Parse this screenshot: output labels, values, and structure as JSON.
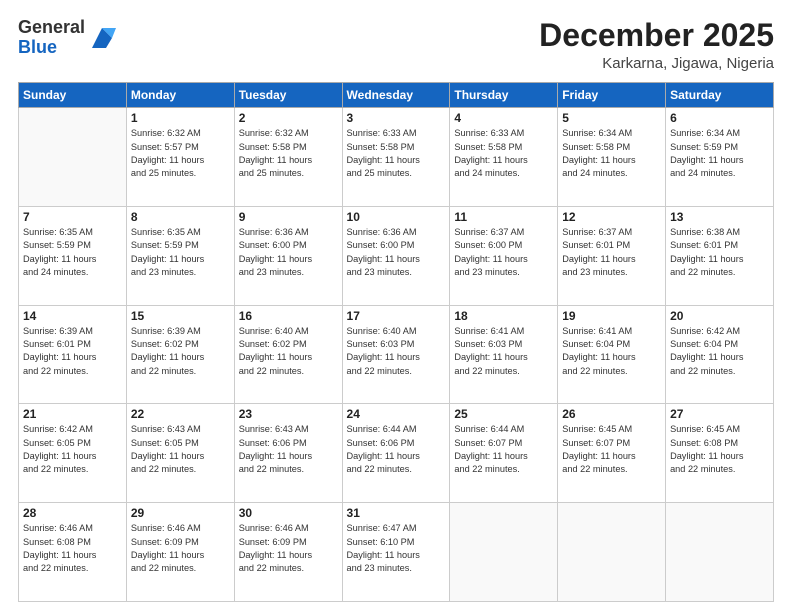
{
  "header": {
    "logo_general": "General",
    "logo_blue": "Blue",
    "month_title": "December 2025",
    "subtitle": "Karkarna, Jigawa, Nigeria"
  },
  "weekdays": [
    "Sunday",
    "Monday",
    "Tuesday",
    "Wednesday",
    "Thursday",
    "Friday",
    "Saturday"
  ],
  "weeks": [
    [
      {
        "day": "",
        "info": ""
      },
      {
        "day": "1",
        "info": "Sunrise: 6:32 AM\nSunset: 5:57 PM\nDaylight: 11 hours\nand 25 minutes."
      },
      {
        "day": "2",
        "info": "Sunrise: 6:32 AM\nSunset: 5:58 PM\nDaylight: 11 hours\nand 25 minutes."
      },
      {
        "day": "3",
        "info": "Sunrise: 6:33 AM\nSunset: 5:58 PM\nDaylight: 11 hours\nand 25 minutes."
      },
      {
        "day": "4",
        "info": "Sunrise: 6:33 AM\nSunset: 5:58 PM\nDaylight: 11 hours\nand 24 minutes."
      },
      {
        "day": "5",
        "info": "Sunrise: 6:34 AM\nSunset: 5:58 PM\nDaylight: 11 hours\nand 24 minutes."
      },
      {
        "day": "6",
        "info": "Sunrise: 6:34 AM\nSunset: 5:59 PM\nDaylight: 11 hours\nand 24 minutes."
      }
    ],
    [
      {
        "day": "7",
        "info": "Sunrise: 6:35 AM\nSunset: 5:59 PM\nDaylight: 11 hours\nand 24 minutes."
      },
      {
        "day": "8",
        "info": "Sunrise: 6:35 AM\nSunset: 5:59 PM\nDaylight: 11 hours\nand 23 minutes."
      },
      {
        "day": "9",
        "info": "Sunrise: 6:36 AM\nSunset: 6:00 PM\nDaylight: 11 hours\nand 23 minutes."
      },
      {
        "day": "10",
        "info": "Sunrise: 6:36 AM\nSunset: 6:00 PM\nDaylight: 11 hours\nand 23 minutes."
      },
      {
        "day": "11",
        "info": "Sunrise: 6:37 AM\nSunset: 6:00 PM\nDaylight: 11 hours\nand 23 minutes."
      },
      {
        "day": "12",
        "info": "Sunrise: 6:37 AM\nSunset: 6:01 PM\nDaylight: 11 hours\nand 23 minutes."
      },
      {
        "day": "13",
        "info": "Sunrise: 6:38 AM\nSunset: 6:01 PM\nDaylight: 11 hours\nand 22 minutes."
      }
    ],
    [
      {
        "day": "14",
        "info": "Sunrise: 6:39 AM\nSunset: 6:01 PM\nDaylight: 11 hours\nand 22 minutes."
      },
      {
        "day": "15",
        "info": "Sunrise: 6:39 AM\nSunset: 6:02 PM\nDaylight: 11 hours\nand 22 minutes."
      },
      {
        "day": "16",
        "info": "Sunrise: 6:40 AM\nSunset: 6:02 PM\nDaylight: 11 hours\nand 22 minutes."
      },
      {
        "day": "17",
        "info": "Sunrise: 6:40 AM\nSunset: 6:03 PM\nDaylight: 11 hours\nand 22 minutes."
      },
      {
        "day": "18",
        "info": "Sunrise: 6:41 AM\nSunset: 6:03 PM\nDaylight: 11 hours\nand 22 minutes."
      },
      {
        "day": "19",
        "info": "Sunrise: 6:41 AM\nSunset: 6:04 PM\nDaylight: 11 hours\nand 22 minutes."
      },
      {
        "day": "20",
        "info": "Sunrise: 6:42 AM\nSunset: 6:04 PM\nDaylight: 11 hours\nand 22 minutes."
      }
    ],
    [
      {
        "day": "21",
        "info": "Sunrise: 6:42 AM\nSunset: 6:05 PM\nDaylight: 11 hours\nand 22 minutes."
      },
      {
        "day": "22",
        "info": "Sunrise: 6:43 AM\nSunset: 6:05 PM\nDaylight: 11 hours\nand 22 minutes."
      },
      {
        "day": "23",
        "info": "Sunrise: 6:43 AM\nSunset: 6:06 PM\nDaylight: 11 hours\nand 22 minutes."
      },
      {
        "day": "24",
        "info": "Sunrise: 6:44 AM\nSunset: 6:06 PM\nDaylight: 11 hours\nand 22 minutes."
      },
      {
        "day": "25",
        "info": "Sunrise: 6:44 AM\nSunset: 6:07 PM\nDaylight: 11 hours\nand 22 minutes."
      },
      {
        "day": "26",
        "info": "Sunrise: 6:45 AM\nSunset: 6:07 PM\nDaylight: 11 hours\nand 22 minutes."
      },
      {
        "day": "27",
        "info": "Sunrise: 6:45 AM\nSunset: 6:08 PM\nDaylight: 11 hours\nand 22 minutes."
      }
    ],
    [
      {
        "day": "28",
        "info": "Sunrise: 6:46 AM\nSunset: 6:08 PM\nDaylight: 11 hours\nand 22 minutes."
      },
      {
        "day": "29",
        "info": "Sunrise: 6:46 AM\nSunset: 6:09 PM\nDaylight: 11 hours\nand 22 minutes."
      },
      {
        "day": "30",
        "info": "Sunrise: 6:46 AM\nSunset: 6:09 PM\nDaylight: 11 hours\nand 22 minutes."
      },
      {
        "day": "31",
        "info": "Sunrise: 6:47 AM\nSunset: 6:10 PM\nDaylight: 11 hours\nand 23 minutes."
      },
      {
        "day": "",
        "info": ""
      },
      {
        "day": "",
        "info": ""
      },
      {
        "day": "",
        "info": ""
      }
    ]
  ]
}
